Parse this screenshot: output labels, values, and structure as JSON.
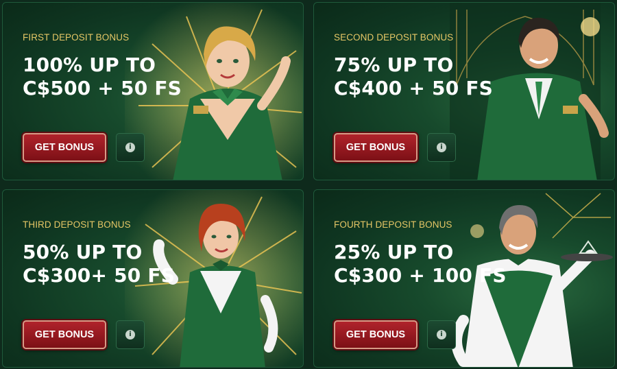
{
  "cards": [
    {
      "eyebrow": "FIRST DEPOSIT BONUS",
      "headline": "100% UP TO C$500 + 50 FS",
      "button_label": "GET BONUS",
      "info_icon": "i"
    },
    {
      "eyebrow": "SECOND DEPOSIT BONUS",
      "headline": "75% UP TO C$400 + 50 FS",
      "button_label": "GET BONUS",
      "info_icon": "i"
    },
    {
      "eyebrow": "THIRD DEPOSIT BONUS",
      "headline": "50% UP TO C$300+ 50 FS",
      "button_label": "GET BONUS",
      "info_icon": "i"
    },
    {
      "eyebrow": "FOURTH DEPOSIT BONUS",
      "headline": "25% UP TO C$300 + 100 FS",
      "button_label": "GET BONUS",
      "info_icon": "i"
    }
  ],
  "colors": {
    "eyebrow": "#e6c766",
    "button_red": "#b0232b",
    "card_green": "#174a2c",
    "uniform_green": "#1f6b3a"
  }
}
